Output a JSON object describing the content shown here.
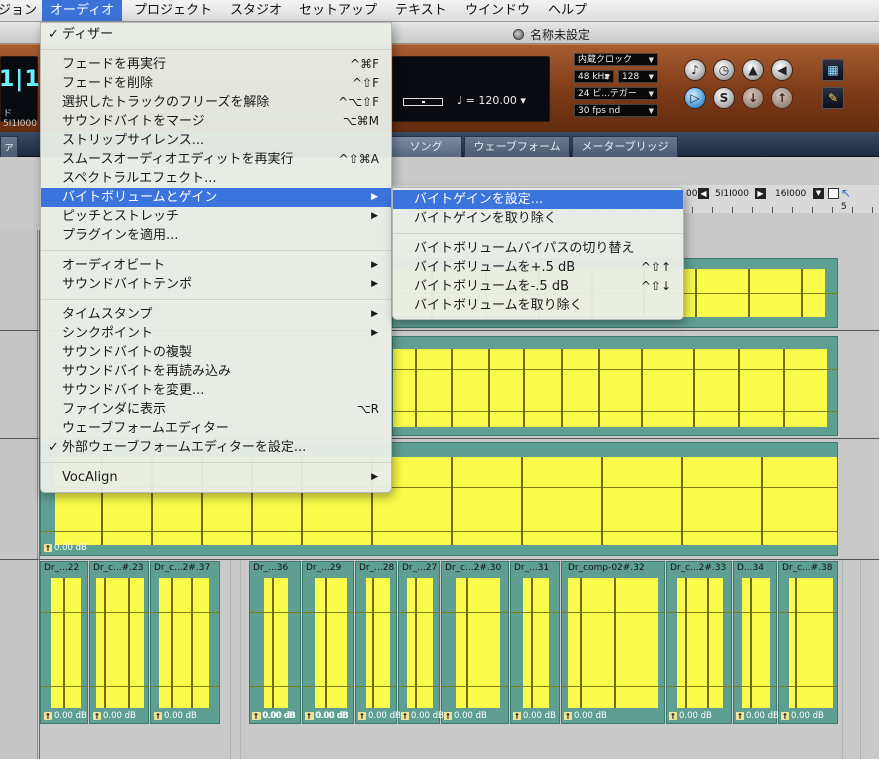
{
  "menubar": [
    "ジョン",
    "オーディオ",
    "プロジェクト",
    "スタジオ",
    "セットアップ",
    "テキスト",
    "ウインドウ",
    "ヘルプ"
  ],
  "window": {
    "title": "名称未設定"
  },
  "transport": {
    "counter_big": "1|1",
    "counter_small": "ド 5I1I000",
    "tempo": "120.00",
    "tempo_symbol": "♩ =",
    "clock": "内蔵クロック",
    "sample_rate": "48 kHz",
    "buffer": "128",
    "bit_depth": "24 ビ...テガー",
    "fps": "30 fps nd"
  },
  "tabs": [
    "ァ",
    "ソング",
    "ウェーブフォーム",
    "メーターブリッジ"
  ],
  "locators": {
    "a": "5I1I000",
    "b": "16I000",
    "left": "00"
  },
  "ruler": {
    "mark": "5"
  },
  "audio_menu": [
    {
      "label": "ディザー",
      "check": true
    },
    {
      "sep": true
    },
    {
      "label": "フェードを再実行",
      "shortcut": "^⌘F"
    },
    {
      "label": "フェードを削除",
      "shortcut": "^⇧F"
    },
    {
      "label": "選択したトラックのフリーズを解除",
      "shortcut": "^⌥⇧F"
    },
    {
      "label": "サウンドバイトをマージ",
      "shortcut": "⌥⌘M"
    },
    {
      "label": "ストリップサイレンス..."
    },
    {
      "label": "スムースオーディオエディットを再実行",
      "shortcut": "^⇧⌘A"
    },
    {
      "label": "スペクトラルエフェクト..."
    },
    {
      "label": "バイトボリュームとゲイン",
      "submenu": true,
      "selected": true
    },
    {
      "label": "ピッチとストレッチ",
      "submenu": true
    },
    {
      "label": "プラグインを適用..."
    },
    {
      "sep": true
    },
    {
      "label": "オーディオビート",
      "submenu": true
    },
    {
      "label": "サウンドバイトテンポ",
      "submenu": true
    },
    {
      "sep": true
    },
    {
      "label": "タイムスタンプ",
      "submenu": true
    },
    {
      "label": "シンクポイント",
      "submenu": true
    },
    {
      "label": "サウンドバイトの複製"
    },
    {
      "label": "サウンドバイトを再読み込み"
    },
    {
      "label": "サウンドバイトを変更..."
    },
    {
      "label": "ファインダに表示",
      "shortcut": "⌥R"
    },
    {
      "label": "ウェーブフォームエディター"
    },
    {
      "label": "外部ウェーブフォームエディターを設定...",
      "check": true
    },
    {
      "sep": true
    },
    {
      "label": "VocAlign",
      "submenu": true
    }
  ],
  "submenu": [
    {
      "label": "バイトゲインを設定...",
      "selected": true
    },
    {
      "label": "バイトゲインを取り除く"
    },
    {
      "sep": true
    },
    {
      "label": "バイトボリュームバイパスの切り替え"
    },
    {
      "label": "バイトボリュームを+.5 dB",
      "shortcut": "^⇧↑"
    },
    {
      "label": "バイトボリュームを-.5 dB",
      "shortcut": "^⇧↓"
    },
    {
      "label": "バイトボリュームを取り除く"
    }
  ],
  "gain_label": "0.00 dB",
  "bottom_regions": [
    "Dr_...22",
    "Dr_c...#.23",
    "Dr_c...2#.37",
    "Dr_...36",
    "Dr_...29",
    "Dr_...28",
    "Dr_...27",
    "Dr_c...2#.30",
    "Dr_...31",
    "Dr_comp-02#.32",
    "Dr_c...2#.33",
    "D...34",
    "Dr_c...#.38"
  ],
  "colors": {
    "menu_highlight": "#3a74dc",
    "region_bg": "#5e9f92",
    "waveform_fill": "#fafb4a",
    "transport": "#7d3a17"
  }
}
